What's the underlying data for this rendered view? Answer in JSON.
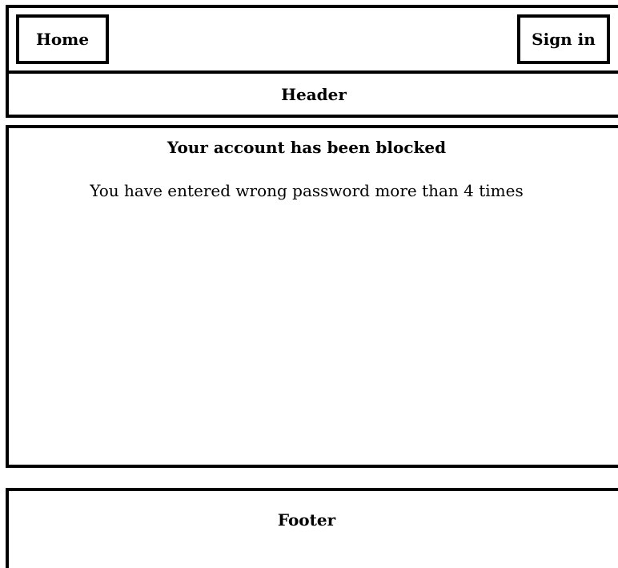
{
  "nav": {
    "home_label": "Home",
    "signin_label": "Sign in"
  },
  "header": {
    "label": "Header"
  },
  "main": {
    "title": "Your account has been blocked",
    "message": "You have entered wrong password more than 4 times"
  },
  "footer": {
    "label": "Footer"
  }
}
